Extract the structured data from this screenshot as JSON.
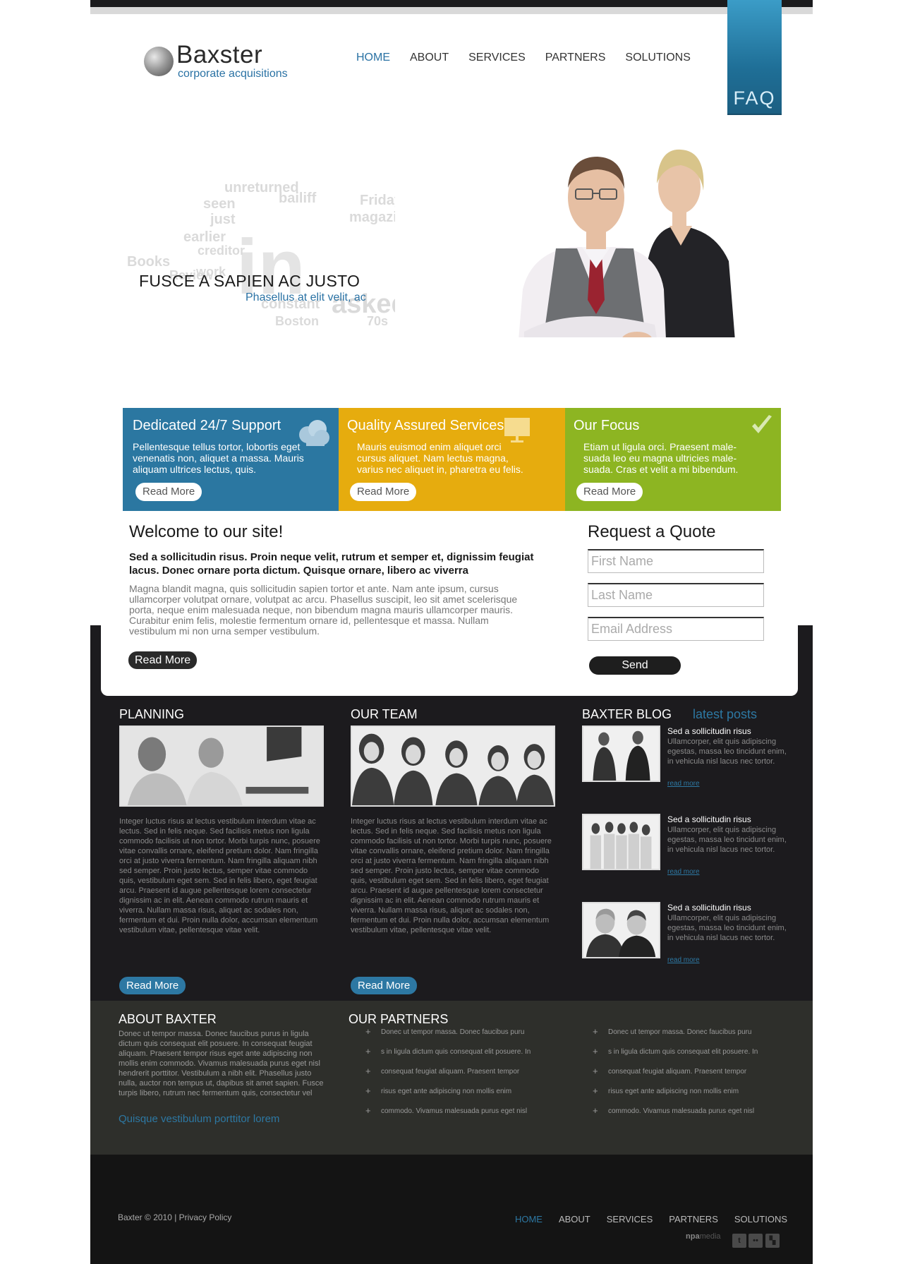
{
  "logo": {
    "name": "Baxster",
    "tagline": "corporate acquisitions"
  },
  "nav": [
    "HOME",
    "ABOUT",
    "SERVICES",
    "PARTNERS",
    "SOLUTIONS"
  ],
  "faq_label": "FAQ",
  "hero": {
    "title": "FUSCE A SAPIEN AC JUSTO",
    "subtitle": "Phasellus at elit velit, ac"
  },
  "features": [
    {
      "title": "Dedicated 24/7 Support",
      "text": "Pellentesque tellus tortor, lobortis eget venenatis non, aliquet a massa. Mauris aliquam ultrices lectus, quis.",
      "button": "Read More",
      "color": "#2b77a1",
      "icon": "cloud-icon"
    },
    {
      "title": "Quality Assured Services",
      "text": "Mauris euismod enim aliquet orci cursus aliquet. Nam lectus magna, varius nec aliquet in, pharetra eu felis.",
      "button": "Read More",
      "color": "#e6ac0e",
      "icon": "presentation-board-icon"
    },
    {
      "title": "Our Focus",
      "text": "Etiam ut ligula orci. Praesent male-suada leo eu magna ultricies male-suada. Cras et velit a mi bibendum.",
      "button": "Read More",
      "color": "#8db522",
      "icon": "checkmark-icon"
    }
  ],
  "welcome": {
    "title": "Welcome to our site!",
    "lead": "Sed a sollicitudin risus. Proin neque velit, rutrum et semper et, dignissim feugiat lacus. Donec ornare porta dictum. Quisque ornare, libero ac viverra",
    "body": "Magna blandit magna, quis sollicitudin sapien tortor et ante. Nam ante ipsum, cursus ullamcorper volutpat ornare, volutpat ac arcu. Phasellus suscipit, leo sit amet scelerisque porta, neque enim malesuada neque, non bibendum magna mauris ullamcorper mauris. Curabitur enim felis, molestie fermentum ornare id, pellentesque et massa. Nullam vestibulum mi non urna semper vestibulum.",
    "button": "Read More"
  },
  "quote": {
    "title": "Request a Quote",
    "first_name_placeholder": "First Name",
    "last_name_placeholder": "Last Name",
    "email_placeholder": "Email Address",
    "button": "Send"
  },
  "columns": [
    {
      "title": "PLANNING",
      "text": "Integer luctus risus at lectus vestibulum interdum vitae ac lectus. Sed in felis neque. Sed facilisis metus non ligula commodo facilisis ut non tortor. Morbi turpis nunc, posuere vitae convallis ornare, eleifend pretium dolor. Nam fringilla orci at justo viverra fermentum. Nam fringilla aliquam nibh sed semper. Proin justo lectus, semper vitae commodo quis, vestibulum eget sem. Sed in felis libero, eget feugiat arcu. Praesent id augue pellentesque lorem consectetur dignissim ac in elit. Aenean commodo rutrum mauris et viverra. Nullam massa risus, aliquet ac sodales non, fermentum et dui. Proin nulla dolor, accumsan elementum vestibulum vitae, pellentesque vitae velit.",
      "button": "Read More"
    },
    {
      "title": "OUR TEAM",
      "text": "Integer luctus risus at lectus vestibulum interdum vitae ac lectus. Sed in felis neque. Sed facilisis metus non ligula commodo facilisis ut non tortor. Morbi turpis nunc, posuere vitae convallis ornare, eleifend pretium dolor. Nam fringilla orci at justo viverra fermentum. Nam fringilla aliquam nibh sed semper. Proin justo lectus, semper vitae commodo quis, vestibulum eget sem. Sed in felis libero, eget feugiat arcu. Praesent id augue pellentesque lorem consectetur dignissim ac in elit. Aenean commodo rutrum mauris et viverra. Nullam massa risus, aliquet ac sodales non, fermentum et dui. Proin nulla dolor, accumsan elementum vestibulum vitae, pellentesque vitae velit.",
      "button": "Read More"
    }
  ],
  "blog": {
    "title": "BAXTER BLOG",
    "subtitle": "latest posts",
    "posts": [
      {
        "title": "Sed a sollicitudin risus",
        "text": "Ullamcorper, elit quis adipiscing egestas, massa leo tincidunt enim, in vehicula nisl lacus nec tortor.",
        "link": "read more"
      },
      {
        "title": "Sed a sollicitudin risus",
        "text": "Ullamcorper, elit quis adipiscing egestas, massa leo tincidunt enim, in vehicula nisl lacus nec tortor.",
        "link": "read more"
      },
      {
        "title": "Sed a sollicitudin risus",
        "text": "Ullamcorper, elit quis adipiscing egestas, massa leo tincidunt enim, in vehicula nisl lacus nec tortor.",
        "link": "read more"
      }
    ]
  },
  "about": {
    "title": "ABOUT BAXTER",
    "text": "Donec ut tempor massa. Donec faucibus purus in ligula dictum quis consequat elit posuere. In consequat feugiat aliquam. Praesent tempor risus eget ante adipiscing non mollis enim commodo. Vivamus malesuada purus eget nisl hendrerit porttitor. Vestibulum a nibh elit. Phasellus justo nulla, auctor non tempus ut, dapibus sit amet sapien. Fusce turpis libero, rutrum nec fermentum quis, consectetur vel",
    "link": "Quisque vestibulum porttitor lorem"
  },
  "partners": {
    "title": "OUR PARTNERS",
    "list_left": [
      "Donec ut tempor massa. Donec faucibus puru",
      "s in ligula dictum quis consequat elit posuere. In",
      "consequat feugiat aliquam. Praesent tempor",
      "risus eget ante adipiscing non mollis enim",
      "commodo. Vivamus malesuada purus eget nisl"
    ],
    "list_right": [
      "Donec ut tempor massa. Donec faucibus puru",
      "s in ligula dictum quis consequat elit posuere. In",
      "consequat feugiat aliquam. Praesent tempor",
      "risus eget ante adipiscing non mollis enim",
      "commodo. Vivamus malesuada purus eget nisl"
    ]
  },
  "footer": {
    "copyright": "Baxter © 2010 | Privacy Policy",
    "nav": [
      "HOME",
      "ABOUT",
      "SERVICES",
      "PARTNERS",
      "SOLUTIONS"
    ],
    "credit_brand": "npa",
    "credit_suffix": "media",
    "social": [
      "twitter-icon",
      "flickr-icon",
      "delicious-icon"
    ]
  }
}
